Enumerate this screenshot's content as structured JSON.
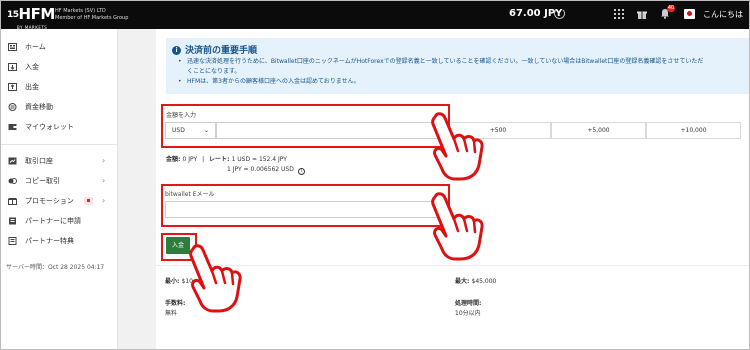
{
  "header": {
    "logo_text": "HFM",
    "logo_prefix": "15",
    "logo_sub": "BY MARKETS",
    "company_line1": "HF Markets (SV) LTD",
    "company_line2": "Member of HF Markets Group",
    "balance": "67.00 JPY",
    "notification_count": "40",
    "greeting": "こんにちは"
  },
  "sidebar": {
    "items": [
      {
        "label": "ホーム",
        "icon": "home-icon"
      },
      {
        "label": "入金",
        "icon": "deposit-icon"
      },
      {
        "label": "出金",
        "icon": "withdraw-icon"
      },
      {
        "label": "資金移動",
        "icon": "transfer-icon"
      },
      {
        "label": "マイウォレット",
        "icon": "wallet-icon"
      },
      {
        "label": "取引口座",
        "icon": "accounts-icon"
      },
      {
        "label": "コピー取引",
        "icon": "copy-trading-icon"
      },
      {
        "label": "プロモーション",
        "icon": "promotion-icon"
      },
      {
        "label": "パートナーに申請",
        "icon": "partner-apply-icon"
      },
      {
        "label": "パートナー特典",
        "icon": "partner-benefits-icon"
      }
    ],
    "server_time_label": "サーバー時間：",
    "server_time": "Oct 28 2025 04:17"
  },
  "notice": {
    "title": "決済前の重要手順",
    "lines": [
      "迅速な決済処理を行うために、Bitwallet口座のニックネームがHotForexでの登録名義と一致していることを確認ください。一致していない場合はBitwallet口座の登録名義確認をさせていただ",
      "くことになります。",
      "HFMは、第3者からの顧客様口座への入金は認めておりません。"
    ]
  },
  "form": {
    "amount_label": "金額を入力",
    "currency": "USD",
    "amount_value": "",
    "quick_amounts": [
      "+500",
      "+5,000",
      "+10,000"
    ],
    "summary_amount_label": "金額",
    "summary_amount": "0 JPY",
    "summary_rate_label": "レート",
    "summary_rate": "1 USD = 152.4 JPY",
    "summary_inverse": "1 JPY = 0.006562 USD",
    "email_label": "bitwallet Eメール",
    "email_value": "",
    "submit_label": "入金"
  },
  "limits": {
    "min_label": "最小",
    "min_value": "$10",
    "max_label": "最大",
    "max_value": "$45,000",
    "fee_label": "手数料",
    "fee_value": "無料",
    "time_label": "処理時間",
    "time_value": "10分以内"
  },
  "colors": {
    "topbar": "#0b0b0b",
    "notice_bg": "#e6f2fb",
    "notice_text": "#14558c",
    "submit_button": "#2f7d3d",
    "highlight": "#e01818"
  }
}
